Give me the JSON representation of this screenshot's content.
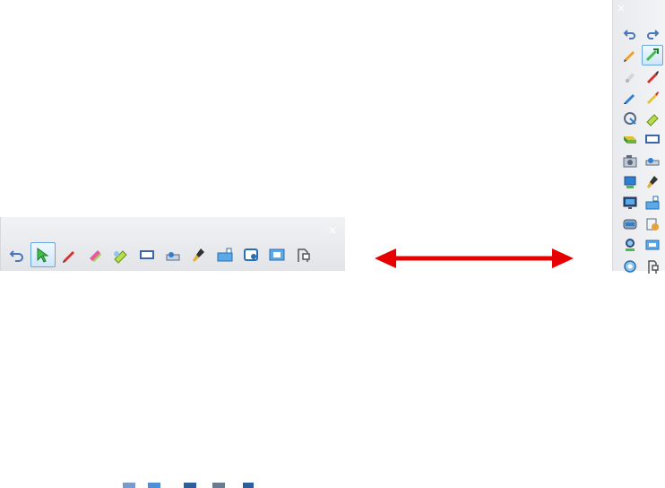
{
  "horizontal_toolbar": {
    "close_glyph": "×",
    "active_tool": "select",
    "tools": [
      "undo-icon",
      "select-icon",
      "pen-icon",
      "highlighter-icon",
      "marker-icon",
      "screen-shade-icon",
      "camera-icon",
      "eraser-brush-icon",
      "keyboard-icon",
      "capture-icon",
      "fullscreen-icon",
      "orientation-toggle-icon"
    ]
  },
  "vertical_toolbar": {
    "close_glyph": "×",
    "active_tool": "select",
    "tools": [
      "undo-icon",
      "redo-icon",
      "pencil-icon",
      "select-icon",
      "creative-pen-icon",
      "red-pen-icon",
      "blue-pen-icon",
      "calligraphy-pen-icon",
      "magic-pen-icon",
      "highlighter-icon",
      "eraser-icon",
      "screen-shade-icon",
      "camera-capture-icon",
      "spotlight-icon",
      "video-capture-icon",
      "fill-tool-icon",
      "slide-show-icon",
      "keyboard-icon",
      "recorder-icon",
      "page-icon",
      "magnifier-icon",
      "fullscreen-icon",
      "settings-icon",
      "orientation-toggle-icon"
    ]
  },
  "colors": {
    "arrow": "#e60000",
    "active_border": "#6aa5dc",
    "toolbar_bg": "#eceef1"
  }
}
